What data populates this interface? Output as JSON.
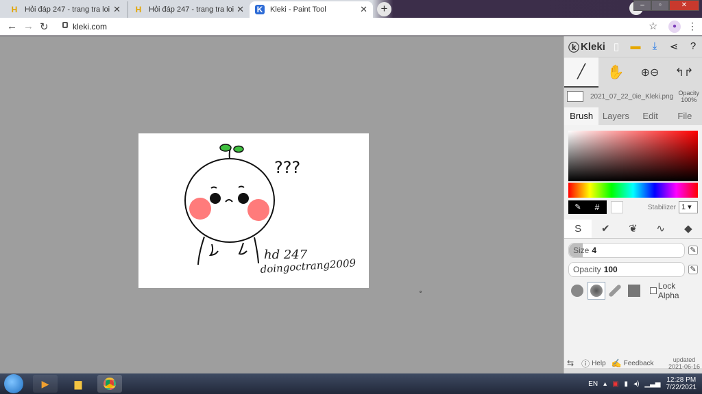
{
  "browser": {
    "tabs": [
      {
        "title": "Hỏi đáp 247 - trang tra loi",
        "favicon": "H"
      },
      {
        "title": "Hỏi đáp 247 - trang tra loi",
        "favicon": "H"
      },
      {
        "title": "Kleki - Paint Tool",
        "favicon": "K"
      }
    ],
    "url": "kleki.com"
  },
  "drawing": {
    "question": "???",
    "signature_line1": "hd 247",
    "signature_line2": "doingoctrang2009"
  },
  "panel": {
    "app_name": "Kleki",
    "file_name": "2021_07_22_0ie_Kleki.png",
    "opacity_label": "Opacity",
    "opacity_value": "100%",
    "tabs": [
      "Brush",
      "Layers",
      "Edit",
      "File"
    ],
    "stabilizer_label": "Stabilizer",
    "stabilizer_value": "1",
    "size_label": "Size",
    "size_value": "4",
    "size_level": 0.12,
    "opacity_slider_label": "Opacity",
    "opacity_slider_value": "100",
    "lock_alpha": "Lock Alpha",
    "help": "Help",
    "feedback": "Feedback",
    "updated_label": "updated",
    "updated_date": "2021-06-16",
    "primary_color": "#000000",
    "secondary_color": "#ffffff"
  },
  "taskbar": {
    "language": "EN",
    "time": "12:28 PM",
    "date": "7/22/2021"
  }
}
